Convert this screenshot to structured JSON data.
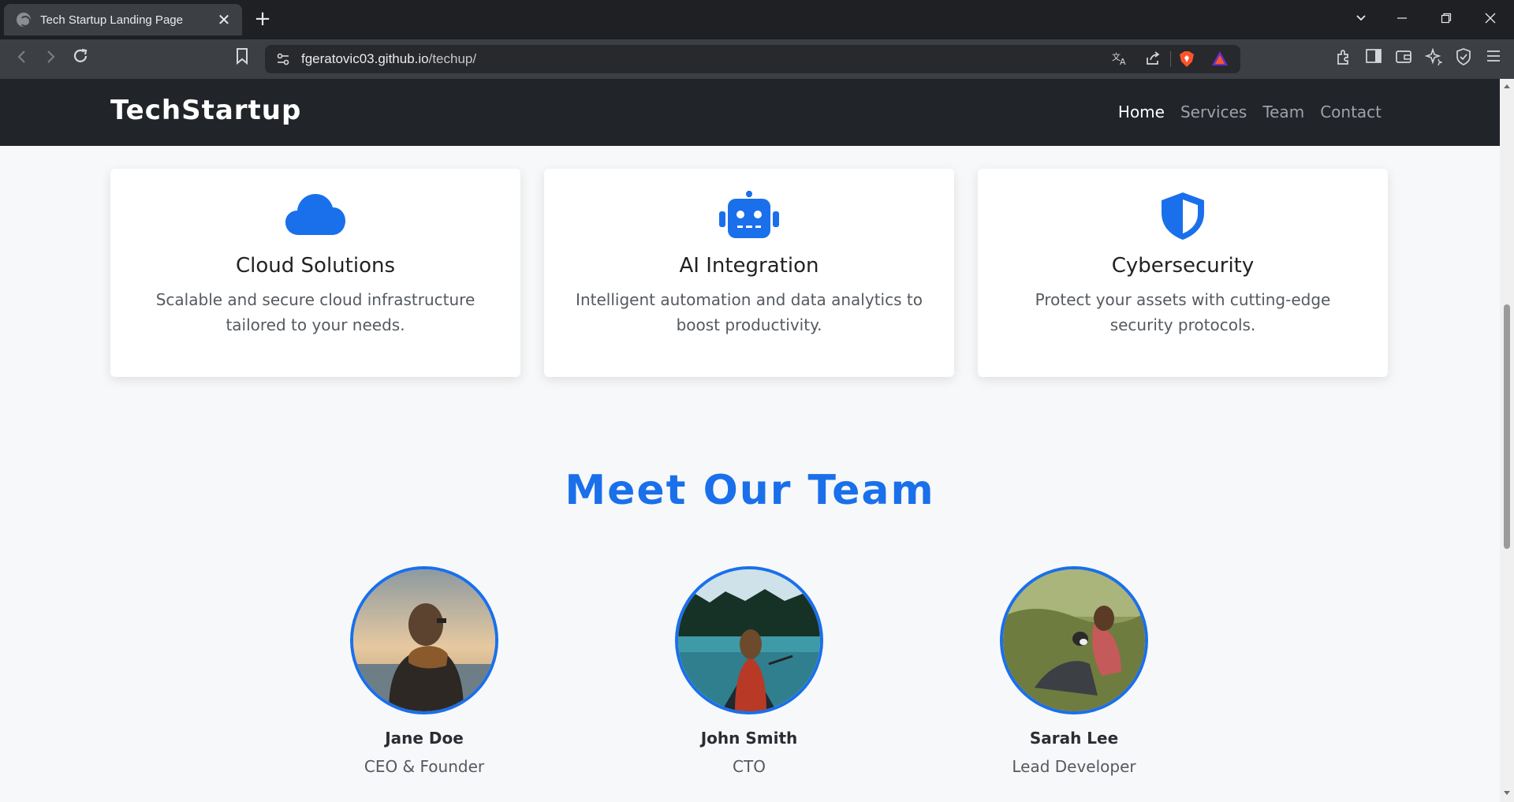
{
  "browser": {
    "tab_title": "Tech Startup Landing Page",
    "tab_close": "✕",
    "new_tab": "+",
    "url_host": "fgeratovic03.github.io",
    "url_path": "/techup/"
  },
  "site": {
    "brand": "TechStartup",
    "nav": [
      {
        "label": "Home",
        "active": true
      },
      {
        "label": "Services",
        "active": false
      },
      {
        "label": "Team",
        "active": false
      },
      {
        "label": "Contact",
        "active": false
      }
    ]
  },
  "services": [
    {
      "icon": "cloud-icon",
      "title": "Cloud Solutions",
      "text": "Scalable and secure cloud infrastructure tailored to your needs."
    },
    {
      "icon": "robot-icon",
      "title": "AI Integration",
      "text": "Intelligent automation and data analytics to boost productivity."
    },
    {
      "icon": "shield-icon",
      "title": "Cybersecurity",
      "text": "Protect your assets with cutting-edge security protocols."
    }
  ],
  "team": {
    "title": "Meet Our Team",
    "members": [
      {
        "name": "Jane Doe",
        "role": "CEO & Founder"
      },
      {
        "name": "John Smith",
        "role": "CTO"
      },
      {
        "name": "Sarah Lee",
        "role": "Lead Developer"
      }
    ]
  },
  "colors": {
    "accent": "#1a6fea",
    "header_bg": "#212428",
    "page_bg": "#f7f8fa"
  }
}
